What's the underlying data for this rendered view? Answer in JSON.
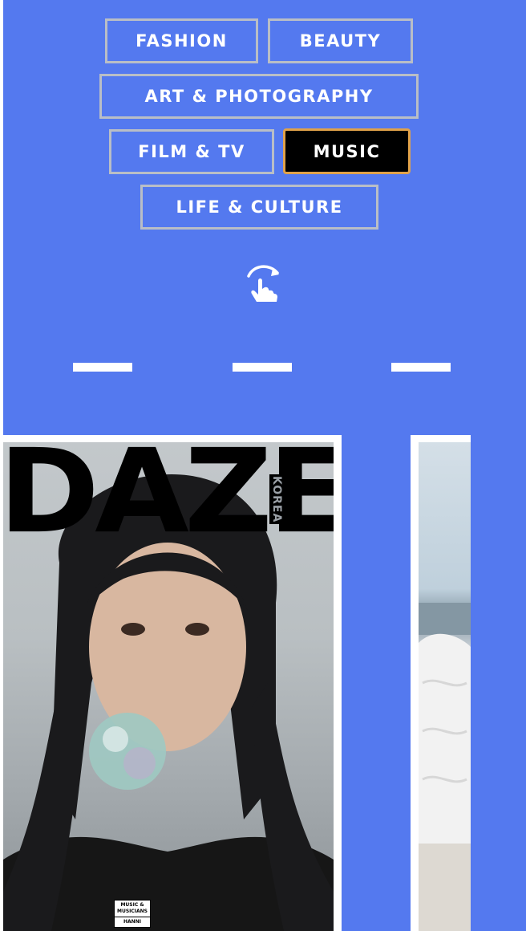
{
  "nav": {
    "categories": [
      {
        "label": "FASHION",
        "active": false
      },
      {
        "label": "BEAUTY",
        "active": false
      },
      {
        "label": "ART & PHOTOGRAPHY",
        "active": false
      },
      {
        "label": "FILM & TV",
        "active": false
      },
      {
        "label": "MUSIC",
        "active": true
      },
      {
        "label": "LIFE & CULTURE",
        "active": false
      }
    ],
    "swipe_icon": "swipe-tap-icon"
  },
  "carousel": {
    "page_indicators": 3,
    "cards": [
      {
        "masthead": "DAZED",
        "edition": "KOREA",
        "badge_line1": "MUSIC &",
        "badge_line2": "MUSICIANS",
        "badge_name": "HANNI"
      },
      {
        "masthead": "",
        "edition": ""
      }
    ]
  },
  "colors": {
    "background": "#5479ef",
    "pill_border": "#b9bec6",
    "active_pill": "#000000",
    "active_border": "#e0a24a",
    "text": "#ffffff"
  }
}
